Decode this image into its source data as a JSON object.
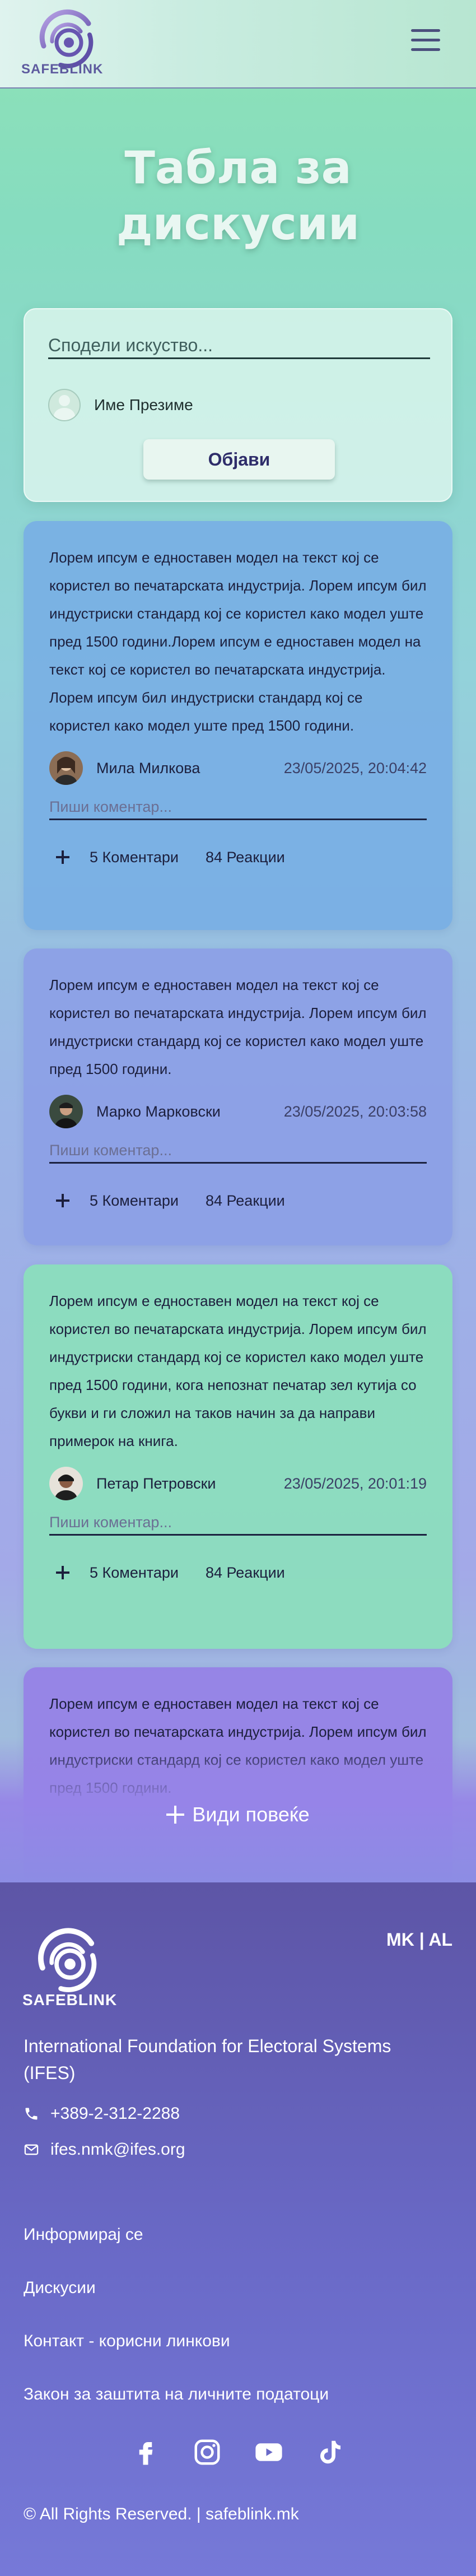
{
  "header": {
    "logo_text": "SAFEBLINK",
    "menu_icon": "hamburger-menu-icon"
  },
  "page_title": "Табла за дискусии",
  "composer": {
    "placeholder": "Сподели искуство...",
    "user_name": "Име Презиме",
    "publish_label": "Објави"
  },
  "posts": [
    {
      "text": "Лорем ипсум е едноставен модел на текст кој се користел во печатарската индустрија. Лорем ипсум бил индустриски стандард кој се користел како модел уште пред 1500 години.Лорем ипсум е едноставен модел на текст кој се користел во печатарската индустрија. Лорем ипсум бил индустриски стандард кој се користел како модел уште пред 1500 години.",
      "author": "Мила Милкова",
      "date": "23/05/2025, 20:04:42",
      "comment_placeholder": "Пиши коментар...",
      "comments": "5 Коментари",
      "reactions": "84 Реакции"
    },
    {
      "text": "Лорем ипсум е едноставен модел на текст кој се користел во печатарската индустрија. Лорем ипсум бил индустриски стандард кој се користел како модел уште пред 1500 години.",
      "author": "Марко Марковски",
      "date": "23/05/2025, 20:03:58",
      "comment_placeholder": "Пиши коментар...",
      "comments": "5 Коментари",
      "reactions": "84 Реакции"
    },
    {
      "text": "Лорем ипсум е едноставен модел на текст кој се користел во печатарската индустрија. Лорем ипсум бил индустриски стандард кој се користел како модел уште пред 1500 години, кога непознат печатар зел кутија со букви и ги сложил на таков начин за да направи примерок на книга.",
      "author": "Петар Петровски",
      "date": "23/05/2025, 20:01:19",
      "comment_placeholder": "Пиши коментар...",
      "comments": "5 Коментари",
      "reactions": "84 Реакции"
    },
    {
      "text": "Лорем ипсум е едноставен модел на текст кој се користел во печатарската индустрија. Лорем ипсум бил индустриски стандард кој се користел како модел уште пред 1500 години."
    }
  ],
  "see_more_label": "Види повеќе",
  "footer": {
    "logo_text": "SAFEBLINK",
    "lang_mk": "MK",
    "lang_sep": " | ",
    "lang_al": "AL",
    "organization": "International Foundation for Electoral Systems (IFES)",
    "phone": "+389-2-312-2288",
    "email": "ifes.nmk@ifes.org",
    "nav": [
      "Информирај се",
      "Дискусии",
      "Контакт - корисни линкови",
      "Закон за заштита на личните податоци"
    ],
    "socials": [
      "facebook-icon",
      "instagram-icon",
      "youtube-icon",
      "tiktok-icon"
    ],
    "copyright": "© All Rights Reserved. | safeblink.mk"
  },
  "colors": {
    "brand_purple": "#5d5a9e",
    "button_text": "#2e2d6a",
    "footer_bg": "#6a6ac8"
  }
}
